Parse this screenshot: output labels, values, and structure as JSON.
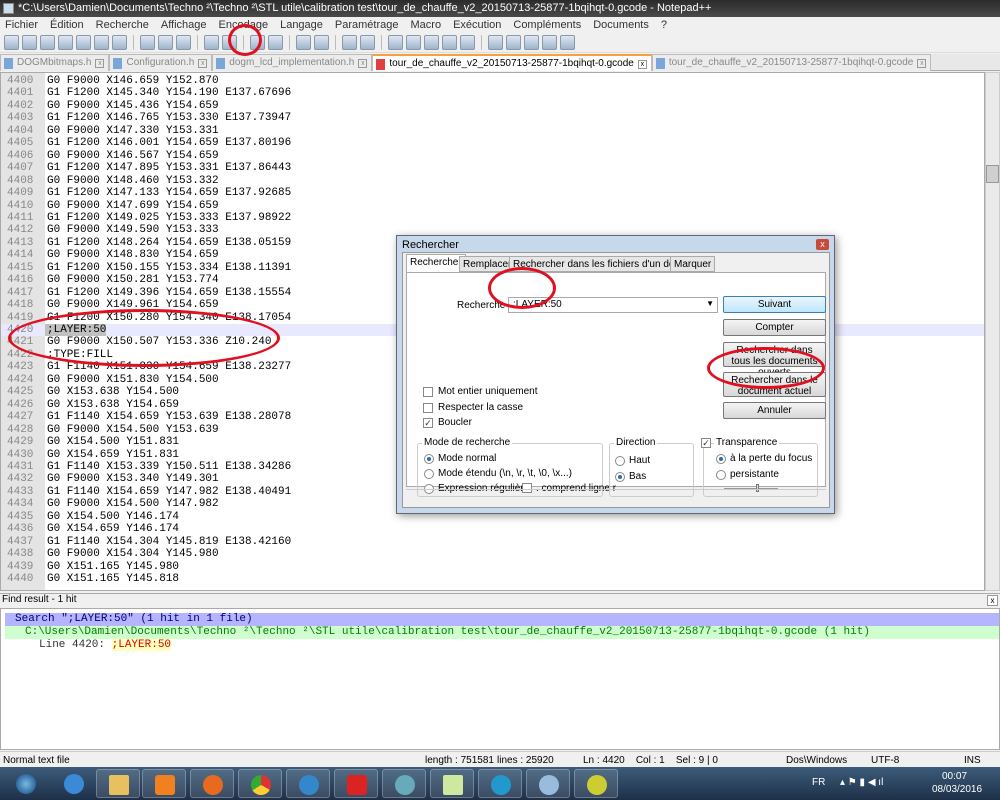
{
  "window": {
    "title": "*C:\\Users\\Damien\\Documents\\Techno ²\\Techno ²\\STL utile\\calibration test\\tour_de_chauffe_v2_20150713-25877-1bqihqt-0.gcode - Notepad++"
  },
  "menu": [
    "Fichier",
    "Édition",
    "Recherche",
    "Affichage",
    "Encodage",
    "Langage",
    "Paramétrage",
    "Macro",
    "Exécution",
    "Compléments",
    "Documents",
    "?"
  ],
  "tabs": [
    {
      "label": "DOGMbitmaps.h",
      "active": false
    },
    {
      "label": "Configuration.h",
      "active": false
    },
    {
      "label": "dogm_lcd_implementation.h",
      "active": false
    },
    {
      "label": "tour_de_chauffe_v2_20150713-25877-1bqihqt-0.gcode",
      "active": true
    },
    {
      "label": "tour_de_chauffe_v2_20150713-25877-1bqihqt-0.gcode",
      "active": false
    }
  ],
  "editor": {
    "current_line": 4420,
    "lines": [
      [
        "4400",
        "G0 F9000 X146.659 Y152.870"
      ],
      [
        "4401",
        "G1 F1200 X145.340 Y154.190 E137.67696"
      ],
      [
        "4402",
        "G0 F9000 X145.436 Y154.659"
      ],
      [
        "4403",
        "G1 F1200 X146.765 Y153.330 E137.73947"
      ],
      [
        "4404",
        "G0 F9000 X147.330 Y153.331"
      ],
      [
        "4405",
        "G1 F1200 X146.001 Y154.659 E137.80196"
      ],
      [
        "4406",
        "G0 F9000 X146.567 Y154.659"
      ],
      [
        "4407",
        "G1 F1200 X147.895 Y153.331 E137.86443"
      ],
      [
        "4408",
        "G0 F9000 X148.460 Y153.332"
      ],
      [
        "4409",
        "G1 F1200 X147.133 Y154.659 E137.92685"
      ],
      [
        "4410",
        "G0 F9000 X147.699 Y154.659"
      ],
      [
        "4411",
        "G1 F1200 X149.025 Y153.333 E137.98922"
      ],
      [
        "4412",
        "G0 F9000 X149.590 Y153.333"
      ],
      [
        "4413",
        "G1 F1200 X148.264 Y154.659 E138.05159"
      ],
      [
        "4414",
        "G0 F9000 X148.830 Y154.659"
      ],
      [
        "4415",
        "G1 F1200 X150.155 Y153.334 E138.11391"
      ],
      [
        "4416",
        "G0 F9000 X150.281 Y153.774"
      ],
      [
        "4417",
        "G1 F1200 X149.396 Y154.659 E138.15554"
      ],
      [
        "4418",
        "G0 F9000 X149.961 Y154.659"
      ],
      [
        "4419",
        "G1 F1200 X150.280 Y154.340 E138.17054"
      ],
      [
        "4420",
        ";LAYER:50"
      ],
      [
        "4421",
        "G0 F9000 X150.507 Y153.336 Z10.240"
      ],
      [
        "4422",
        ";TYPE:FILL"
      ],
      [
        "4423",
        "G1 F1140 X151.830 Y154.659 E138.23277"
      ],
      [
        "4424",
        "G0 F9000 X151.830 Y154.500"
      ],
      [
        "4425",
        "G0 X153.638 Y154.500"
      ],
      [
        "4426",
        "G0 X153.638 Y154.659"
      ],
      [
        "4427",
        "G1 F1140 X154.659 Y153.639 E138.28078"
      ],
      [
        "4428",
        "G0 F9000 X154.500 Y153.639"
      ],
      [
        "4429",
        "G0 X154.500 Y151.831"
      ],
      [
        "4430",
        "G0 X154.659 Y151.831"
      ],
      [
        "4431",
        "G1 F1140 X153.339 Y150.511 E138.34286"
      ],
      [
        "4432",
        "G0 F9000 X153.340 Y149.301"
      ],
      [
        "4433",
        "G1 F1140 X154.659 Y147.982 E138.40491"
      ],
      [
        "4434",
        "G0 F9000 X154.500 Y147.982"
      ],
      [
        "4435",
        "G0 X154.500 Y146.174"
      ],
      [
        "4436",
        "G0 X154.659 Y146.174"
      ],
      [
        "4437",
        "G1 F1140 X154.304 Y145.819 E138.42160"
      ],
      [
        "4438",
        "G0 F9000 X154.304 Y145.980"
      ],
      [
        "4439",
        "G0 X151.165 Y145.980"
      ],
      [
        "4440",
        "G0 X151.165 Y145.818"
      ]
    ]
  },
  "dialog": {
    "title": "Rechercher",
    "close": "x",
    "tabs": [
      "Rechercher",
      "Remplacer",
      "Rechercher dans les fichiers d'un dossier",
      "Marquer"
    ],
    "search_label": "Recherche :",
    "search_value": ";LAYER:50",
    "buttons": {
      "next": "Suivant",
      "count": "Compter",
      "find_all_open": "Rechercher dans tous les documents ouverts",
      "find_all_current": "Rechercher dans le document actuel",
      "cancel": "Annuler"
    },
    "options": {
      "whole_word": "Mot entier uniquement",
      "match_case": "Respecter la casse",
      "wrap": "Boucler"
    },
    "mode": {
      "title": "Mode de recherche",
      "normal": "Mode normal",
      "extended": "Mode étendu (\\n, \\r, \\t, \\0, \\x...)",
      "regex": "Expression régulière",
      "dot_newline": ". comprend ligne r"
    },
    "direction": {
      "title": "Direction",
      "up": "Haut",
      "down": "Bas"
    },
    "transparency": {
      "title": "Transparence",
      "on_focus_loss": "à la perte du focus",
      "always": "persistante"
    }
  },
  "find_result": {
    "header": "Find result - 1 hit",
    "close": "x",
    "search_line": "Search \";LAYER:50\" (1 hit in 1 file)",
    "file_line": "C:\\Users\\Damien\\Documents\\Techno ²\\Techno ²\\STL utile\\calibration test\\tour_de_chauffe_v2_20150713-25877-1bqihqt-0.gcode (1 hit)",
    "hit_prefix": "Line 4420: ",
    "hit_text": ";LAYER:50"
  },
  "status": {
    "type": "Normal text file",
    "length": "length : 751581",
    "lines": "lines : 25920",
    "pos": "Ln : 4420    Col : 1    Sel : 9 | 0",
    "eol": "Dos\\Windows",
    "encoding": "UTF-8",
    "mode": "INS"
  },
  "taskbar": {
    "lang": "FR",
    "time": "00:07",
    "date": "08/03/2016"
  }
}
